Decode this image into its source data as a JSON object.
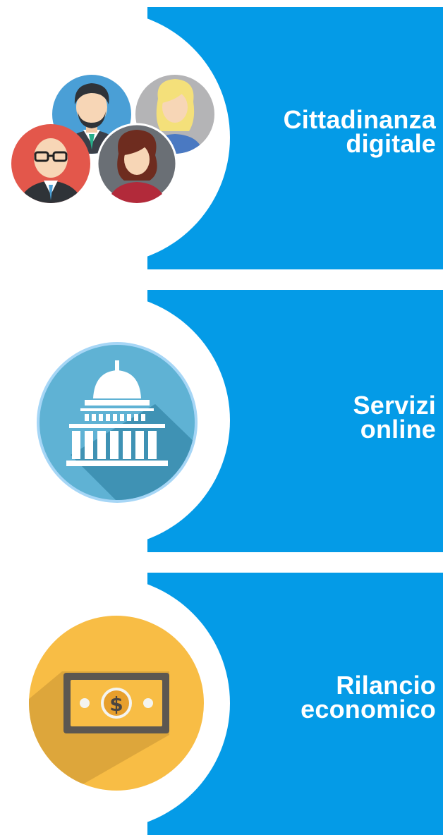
{
  "items": [
    {
      "title_line1": "Cittadinanza",
      "title_line2": "digitale",
      "icon": "people-group-icon"
    },
    {
      "title_line1": "Servizi",
      "title_line2": "online",
      "icon": "capitol-building-icon"
    },
    {
      "title_line1": "Rilancio",
      "title_line2": "economico",
      "icon": "money-bill-icon"
    }
  ],
  "colors": {
    "card_blue": "#049be7",
    "capitol_bg": "#5fb2d4",
    "money_bg": "#f8bd45"
  }
}
